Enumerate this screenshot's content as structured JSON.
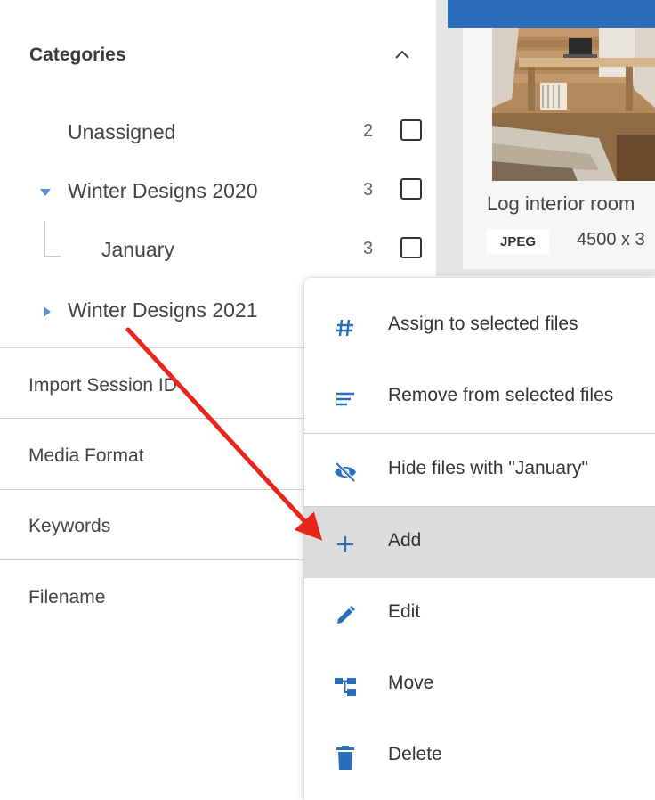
{
  "sidebar": {
    "categories_title": "Categories",
    "tree": [
      {
        "label": "Unassigned",
        "count": "2"
      },
      {
        "label": "Winter Designs 2020",
        "count": "3"
      },
      {
        "label": "January",
        "count": "3"
      },
      {
        "label": "Winter Designs 2021",
        "count": ""
      }
    ],
    "filters": [
      {
        "label": "Import Session ID"
      },
      {
        "label": "Media Format"
      },
      {
        "label": "Keywords"
      },
      {
        "label": "Filename"
      }
    ]
  },
  "card": {
    "title": "Log interior room",
    "format": "JPEG",
    "dimensions": "4500 x 3"
  },
  "context_menu": {
    "items": [
      {
        "label": "Assign to selected files",
        "icon": "hash-icon"
      },
      {
        "label": "Remove from selected files",
        "icon": "remove-lines-icon"
      },
      {
        "label": "Hide files with \"January\"",
        "icon": "eye-off-icon"
      },
      {
        "label": "Add",
        "icon": "plus-icon"
      },
      {
        "label": "Edit",
        "icon": "pencil-icon"
      },
      {
        "label": "Move",
        "icon": "move-tree-icon"
      },
      {
        "label": "Delete",
        "icon": "trash-icon"
      }
    ],
    "highlighted": "Add"
  },
  "colors": {
    "accent": "#2a6ebb",
    "annotation_arrow": "#e8261e",
    "highlight": "#dcdcdc"
  }
}
